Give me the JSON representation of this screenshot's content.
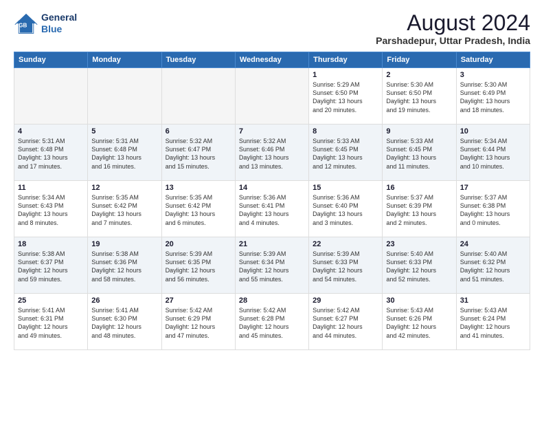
{
  "header": {
    "logo_line1": "General",
    "logo_line2": "Blue",
    "title": "August 2024",
    "subtitle": "Parshadepur, Uttar Pradesh, India"
  },
  "weekdays": [
    "Sunday",
    "Monday",
    "Tuesday",
    "Wednesday",
    "Thursday",
    "Friday",
    "Saturday"
  ],
  "weeks": [
    [
      {
        "day": "",
        "info": ""
      },
      {
        "day": "",
        "info": ""
      },
      {
        "day": "",
        "info": ""
      },
      {
        "day": "",
        "info": ""
      },
      {
        "day": "1",
        "info": "Sunrise: 5:29 AM\nSunset: 6:50 PM\nDaylight: 13 hours\nand 20 minutes."
      },
      {
        "day": "2",
        "info": "Sunrise: 5:30 AM\nSunset: 6:50 PM\nDaylight: 13 hours\nand 19 minutes."
      },
      {
        "day": "3",
        "info": "Sunrise: 5:30 AM\nSunset: 6:49 PM\nDaylight: 13 hours\nand 18 minutes."
      }
    ],
    [
      {
        "day": "4",
        "info": "Sunrise: 5:31 AM\nSunset: 6:48 PM\nDaylight: 13 hours\nand 17 minutes."
      },
      {
        "day": "5",
        "info": "Sunrise: 5:31 AM\nSunset: 6:48 PM\nDaylight: 13 hours\nand 16 minutes."
      },
      {
        "day": "6",
        "info": "Sunrise: 5:32 AM\nSunset: 6:47 PM\nDaylight: 13 hours\nand 15 minutes."
      },
      {
        "day": "7",
        "info": "Sunrise: 5:32 AM\nSunset: 6:46 PM\nDaylight: 13 hours\nand 13 minutes."
      },
      {
        "day": "8",
        "info": "Sunrise: 5:33 AM\nSunset: 6:45 PM\nDaylight: 13 hours\nand 12 minutes."
      },
      {
        "day": "9",
        "info": "Sunrise: 5:33 AM\nSunset: 6:45 PM\nDaylight: 13 hours\nand 11 minutes."
      },
      {
        "day": "10",
        "info": "Sunrise: 5:34 AM\nSunset: 6:44 PM\nDaylight: 13 hours\nand 10 minutes."
      }
    ],
    [
      {
        "day": "11",
        "info": "Sunrise: 5:34 AM\nSunset: 6:43 PM\nDaylight: 13 hours\nand 8 minutes."
      },
      {
        "day": "12",
        "info": "Sunrise: 5:35 AM\nSunset: 6:42 PM\nDaylight: 13 hours\nand 7 minutes."
      },
      {
        "day": "13",
        "info": "Sunrise: 5:35 AM\nSunset: 6:42 PM\nDaylight: 13 hours\nand 6 minutes."
      },
      {
        "day": "14",
        "info": "Sunrise: 5:36 AM\nSunset: 6:41 PM\nDaylight: 13 hours\nand 4 minutes."
      },
      {
        "day": "15",
        "info": "Sunrise: 5:36 AM\nSunset: 6:40 PM\nDaylight: 13 hours\nand 3 minutes."
      },
      {
        "day": "16",
        "info": "Sunrise: 5:37 AM\nSunset: 6:39 PM\nDaylight: 13 hours\nand 2 minutes."
      },
      {
        "day": "17",
        "info": "Sunrise: 5:37 AM\nSunset: 6:38 PM\nDaylight: 13 hours\nand 0 minutes."
      }
    ],
    [
      {
        "day": "18",
        "info": "Sunrise: 5:38 AM\nSunset: 6:37 PM\nDaylight: 12 hours\nand 59 minutes."
      },
      {
        "day": "19",
        "info": "Sunrise: 5:38 AM\nSunset: 6:36 PM\nDaylight: 12 hours\nand 58 minutes."
      },
      {
        "day": "20",
        "info": "Sunrise: 5:39 AM\nSunset: 6:35 PM\nDaylight: 12 hours\nand 56 minutes."
      },
      {
        "day": "21",
        "info": "Sunrise: 5:39 AM\nSunset: 6:34 PM\nDaylight: 12 hours\nand 55 minutes."
      },
      {
        "day": "22",
        "info": "Sunrise: 5:39 AM\nSunset: 6:33 PM\nDaylight: 12 hours\nand 54 minutes."
      },
      {
        "day": "23",
        "info": "Sunrise: 5:40 AM\nSunset: 6:33 PM\nDaylight: 12 hours\nand 52 minutes."
      },
      {
        "day": "24",
        "info": "Sunrise: 5:40 AM\nSunset: 6:32 PM\nDaylight: 12 hours\nand 51 minutes."
      }
    ],
    [
      {
        "day": "25",
        "info": "Sunrise: 5:41 AM\nSunset: 6:31 PM\nDaylight: 12 hours\nand 49 minutes."
      },
      {
        "day": "26",
        "info": "Sunrise: 5:41 AM\nSunset: 6:30 PM\nDaylight: 12 hours\nand 48 minutes."
      },
      {
        "day": "27",
        "info": "Sunrise: 5:42 AM\nSunset: 6:29 PM\nDaylight: 12 hours\nand 47 minutes."
      },
      {
        "day": "28",
        "info": "Sunrise: 5:42 AM\nSunset: 6:28 PM\nDaylight: 12 hours\nand 45 minutes."
      },
      {
        "day": "29",
        "info": "Sunrise: 5:42 AM\nSunset: 6:27 PM\nDaylight: 12 hours\nand 44 minutes."
      },
      {
        "day": "30",
        "info": "Sunrise: 5:43 AM\nSunset: 6:26 PM\nDaylight: 12 hours\nand 42 minutes."
      },
      {
        "day": "31",
        "info": "Sunrise: 5:43 AM\nSunset: 6:24 PM\nDaylight: 12 hours\nand 41 minutes."
      }
    ]
  ]
}
